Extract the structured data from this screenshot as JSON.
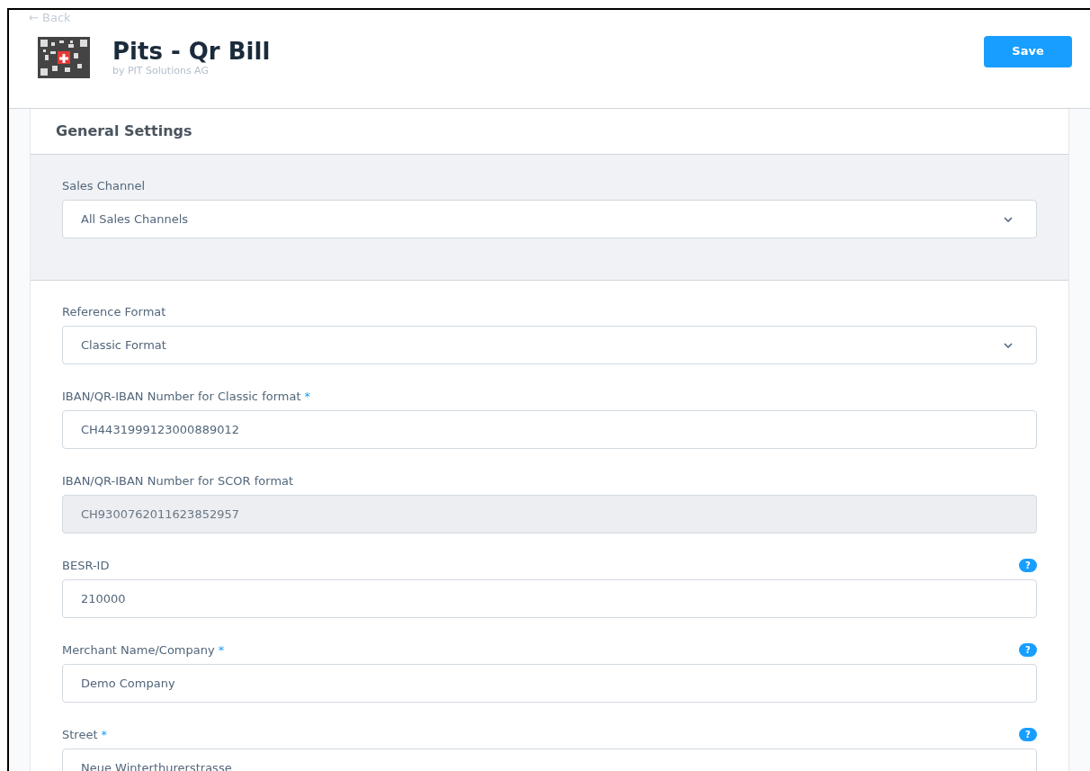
{
  "header": {
    "back_link": "← Back",
    "app_title": "Pits - Qr Bill",
    "app_vendor": "by PIT Solutions AG",
    "save_button": "Save"
  },
  "card": {
    "title": "General Settings",
    "sales_channel": {
      "label": "Sales Channel",
      "value": "All Sales Channels"
    },
    "fields": [
      {
        "kind": "select",
        "label": "Reference Format",
        "value": "Classic Format"
      },
      {
        "kind": "text",
        "label": "IBAN/QR-IBAN Number for Classic format",
        "required_mark": "*",
        "value": "CH4431999123000889012"
      },
      {
        "kind": "disabled",
        "label": "IBAN/QR-IBAN Number for SCOR format",
        "value": "CH9300762011623852957"
      },
      {
        "kind": "text",
        "label": "BESR-ID",
        "value": "210000",
        "help_mark": "?"
      },
      {
        "kind": "text",
        "label": "Merchant Name/Company",
        "required_mark": "*",
        "value": "Demo Company",
        "help_mark": "?"
      },
      {
        "kind": "text",
        "label": "Street",
        "required_mark": "*",
        "value": "Neue Winterthurerstrasse",
        "help_mark": "?"
      }
    ]
  }
}
